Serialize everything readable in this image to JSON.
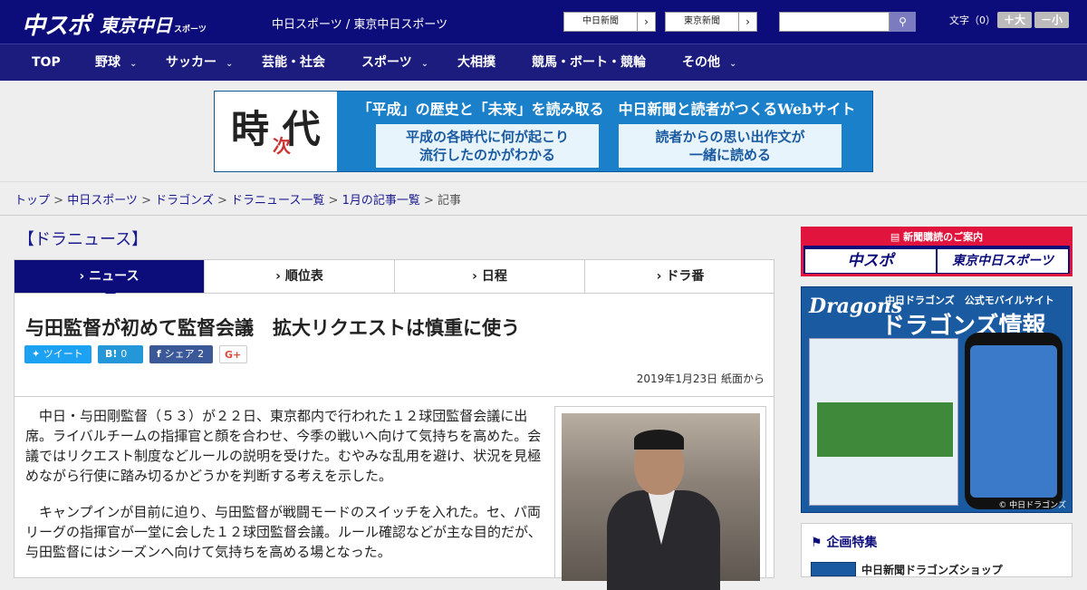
{
  "header": {
    "logo_chusupo": "中スポ",
    "logo_tokyo": "東京中日",
    "logo_tokyo_sub": "スポーツ",
    "site_name": "中日スポーツ / 東京中日スポーツ",
    "btn_chunichi": "中日新聞",
    "btn_tokyo": "東京新聞",
    "font_label": "文字（0）",
    "font_up": "＋大",
    "font_down": "－小"
  },
  "nav": [
    {
      "label": "TOP",
      "has_chevron": false
    },
    {
      "label": "野球",
      "has_chevron": true
    },
    {
      "label": "サッカー",
      "has_chevron": true
    },
    {
      "label": "芸能・社会",
      "has_chevron": false
    },
    {
      "label": "スポーツ",
      "has_chevron": true
    },
    {
      "label": "大相撲",
      "has_chevron": false
    },
    {
      "label": "競馬・ボート・競輪",
      "has_chevron": false
    },
    {
      "label": "その他",
      "has_chevron": true
    }
  ],
  "banner": {
    "kanji_main": "時 代",
    "kanji_sub": "次",
    "headline": "「平成」の歴史と「未来」を読み取る　中日新聞と読者がつくるWebサイト",
    "box1": "平成の各時代に何が起こり\n流行したのかがわかる",
    "box2": "読者からの思い出作文が\n一緒に読める"
  },
  "breadcrumb": {
    "top": "トップ",
    "chunichi": "中日スポーツ",
    "dragons": "ドラゴンズ",
    "news_list": "ドラニュース一覧",
    "month_list": "1月の記事一覧",
    "current": "記事",
    "sep": " > "
  },
  "category": "【ドラニュース】",
  "tabs": [
    "ニュース",
    "順位表",
    "日程",
    "ドラ番"
  ],
  "article": {
    "title": "与田監督が初めて監督会議　拡大リクエストは慎重に使う",
    "share_tweet": "ツイート",
    "share_hatena": "0",
    "share_fb": "シェア 2",
    "share_gplus": "G+",
    "date": "2019年1月23日 紙面から",
    "para1": "　中日・与田剛監督（５３）が２２日、東京都内で行われた１２球団監督会議に出席。ライバルチームの指揮官と顔を合わせ、今季の戦いへ向けて気持ちを高めた。会議ではリクエスト制度などルールの説明を受けた。むやみな乱用を避け、状況を見極めながら行使に踏み切るかどうかを判断する考えを示した。",
    "para2": "　キャンプインが目前に迫り、与田監督が戦闘モードのスイッチを入れた。セ、パ両リーグの指揮官が一堂に会した１２球団監督会議。ルール確認などが主な目的だが、与田監督にはシーズンへ向けて気持ちを高める場となった。"
  },
  "sidebar": {
    "subscribe_head": "新聞購読のご案内",
    "subscribe_chusupo": "中スポ",
    "subscribe_tokyo": "東京中日スポーツ",
    "dragons_logo": "Dragons",
    "dragons_t1": "中日ドラゴンズ　公式モバイルサイト",
    "dragons_t2": "ドラゴンズ情報",
    "dragons_copy": "© 中日ドラゴンズ",
    "feature_head": "企画特集",
    "feature_item": "中日新聞ドラゴンズショップ"
  }
}
